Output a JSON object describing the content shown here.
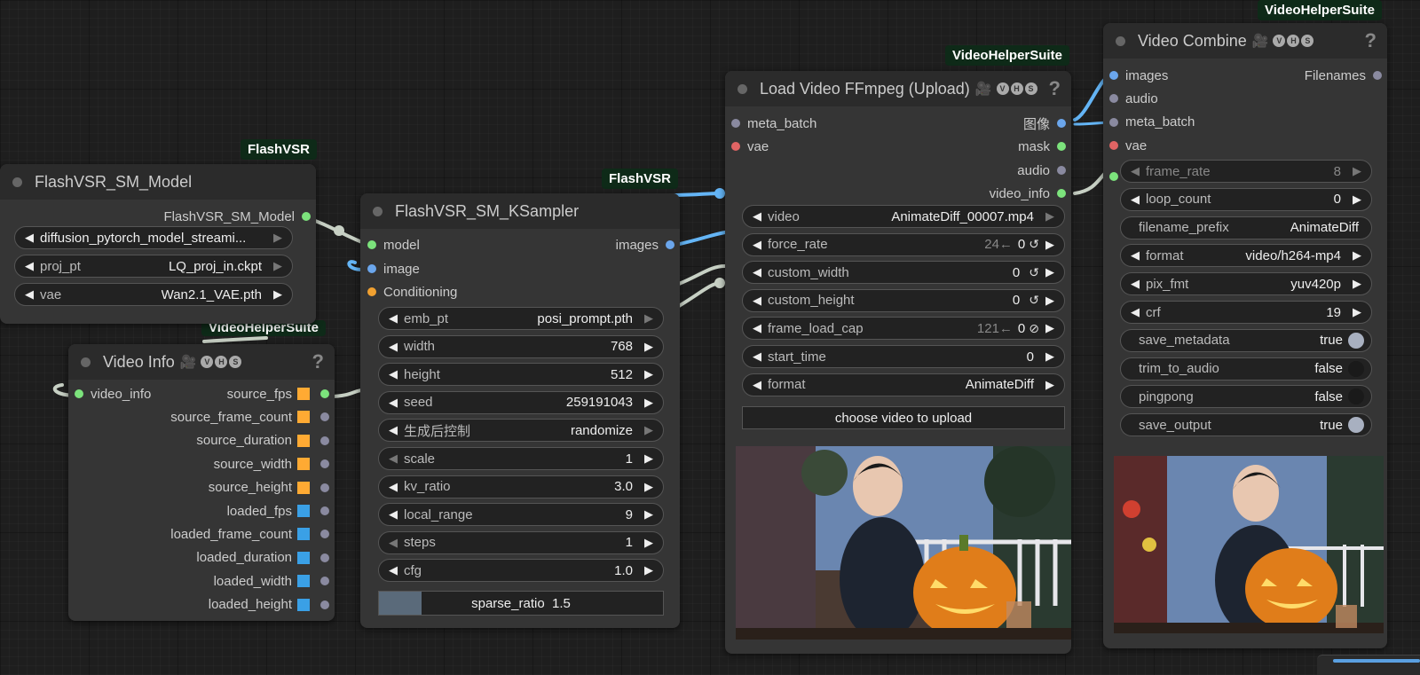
{
  "colors": {
    "link": "#c7d0c4",
    "link_blue": "#64b5f6",
    "slot_grey": "#8a8aa0",
    "slot_green": "#7ce37c",
    "slot_blue": "#6ba6ec",
    "slot_red": "#e06464",
    "slot_orange": "#f0a030",
    "square_orange": "#ffaa33",
    "square_blue": "#3aa0e6"
  },
  "model_node": {
    "source": "FlashVSR",
    "title": "FlashVSR_SM_Model",
    "output": "FlashVSR_SM_Model",
    "widgets": [
      {
        "label": "",
        "value": "diffusion_pytorch_model_streami..."
      },
      {
        "label": "proj_pt",
        "value": "LQ_proj_in.ckpt"
      },
      {
        "label": "vae",
        "value": "Wan2.1_VAE.pth"
      }
    ]
  },
  "ksampler_node": {
    "source": "FlashVSR",
    "title": "FlashVSR_SM_KSampler",
    "inputs": [
      "model",
      "image",
      "Conditioning"
    ],
    "output": "images",
    "widgets": [
      {
        "label": "emb_pt",
        "value": "posi_prompt.pth"
      },
      {
        "label": "width",
        "value": "768"
      },
      {
        "label": "height",
        "value": "512"
      },
      {
        "label": "seed",
        "value": "259191043"
      },
      {
        "label": "生成后控制",
        "value": "randomize"
      },
      {
        "label": "scale",
        "value": "1"
      },
      {
        "label": "kv_ratio",
        "value": "3.0"
      },
      {
        "label": "local_range",
        "value": "9"
      },
      {
        "label": "steps",
        "value": "1"
      },
      {
        "label": "cfg",
        "value": "1.0"
      }
    ],
    "slider": {
      "label": "sparse_ratio",
      "value": "1.5",
      "fill_fraction": 0.15
    }
  },
  "video_info_node": {
    "source": "VideoHelperSuite",
    "title": "Video Info",
    "input": "video_info",
    "help": "?",
    "outputs": [
      {
        "label": "source_fps",
        "kind": "orange"
      },
      {
        "label": "source_frame_count",
        "kind": "orange"
      },
      {
        "label": "source_duration",
        "kind": "orange"
      },
      {
        "label": "source_width",
        "kind": "orange"
      },
      {
        "label": "source_height",
        "kind": "orange"
      },
      {
        "label": "loaded_fps",
        "kind": "blue"
      },
      {
        "label": "loaded_frame_count",
        "kind": "blue"
      },
      {
        "label": "loaded_duration",
        "kind": "blue"
      },
      {
        "label": "loaded_width",
        "kind": "blue"
      },
      {
        "label": "loaded_height",
        "kind": "blue"
      }
    ]
  },
  "load_video_node": {
    "source": "VideoHelperSuite",
    "title": "Load Video FFmpeg (Upload)",
    "help": "?",
    "inputs": [
      "meta_batch",
      "vae"
    ],
    "outputs": [
      "图像",
      "mask",
      "audio",
      "video_info"
    ],
    "widgets": [
      {
        "label": "video",
        "value": "AnimateDiff_00007.mp4",
        "ghost": "",
        "sym": ""
      },
      {
        "label": "force_rate",
        "value": "0",
        "ghost": "24←",
        "sym": "↺"
      },
      {
        "label": "custom_width",
        "value": "0",
        "ghost": "",
        "sym": "↺"
      },
      {
        "label": "custom_height",
        "value": "0",
        "ghost": "",
        "sym": "↺"
      },
      {
        "label": "frame_load_cap",
        "value": "0",
        "ghost": "121←",
        "sym": "⊘"
      },
      {
        "label": "start_time",
        "value": "0",
        "ghost": "",
        "sym": ""
      },
      {
        "label": "format",
        "value": "AnimateDiff",
        "ghost": "",
        "sym": ""
      }
    ],
    "button": "choose video to upload"
  },
  "video_combine_node": {
    "source": "VideoHelperSuite",
    "title": "Video Combine",
    "help": "?",
    "inputs": [
      "images",
      "audio",
      "meta_batch",
      "vae"
    ],
    "output": "Filenames",
    "widgets": [
      {
        "label": "frame_rate",
        "value": "8",
        "type": "number",
        "disabled": true
      },
      {
        "label": "loop_count",
        "value": "0",
        "type": "number"
      },
      {
        "label": "filename_prefix",
        "value": "AnimateDiff",
        "type": "text"
      },
      {
        "label": "format",
        "value": "video/h264-mp4",
        "type": "number"
      },
      {
        "label": "pix_fmt",
        "value": "yuv420p",
        "type": "number"
      },
      {
        "label": "crf",
        "value": "19",
        "type": "number"
      },
      {
        "label": "save_metadata",
        "value": "true",
        "type": "toggle",
        "on": true
      },
      {
        "label": "trim_to_audio",
        "value": "false",
        "type": "toggle",
        "on": false
      },
      {
        "label": "pingpong",
        "value": "false",
        "type": "toggle",
        "on": false
      },
      {
        "label": "save_output",
        "value": "true",
        "type": "toggle",
        "on": true
      }
    ]
  }
}
